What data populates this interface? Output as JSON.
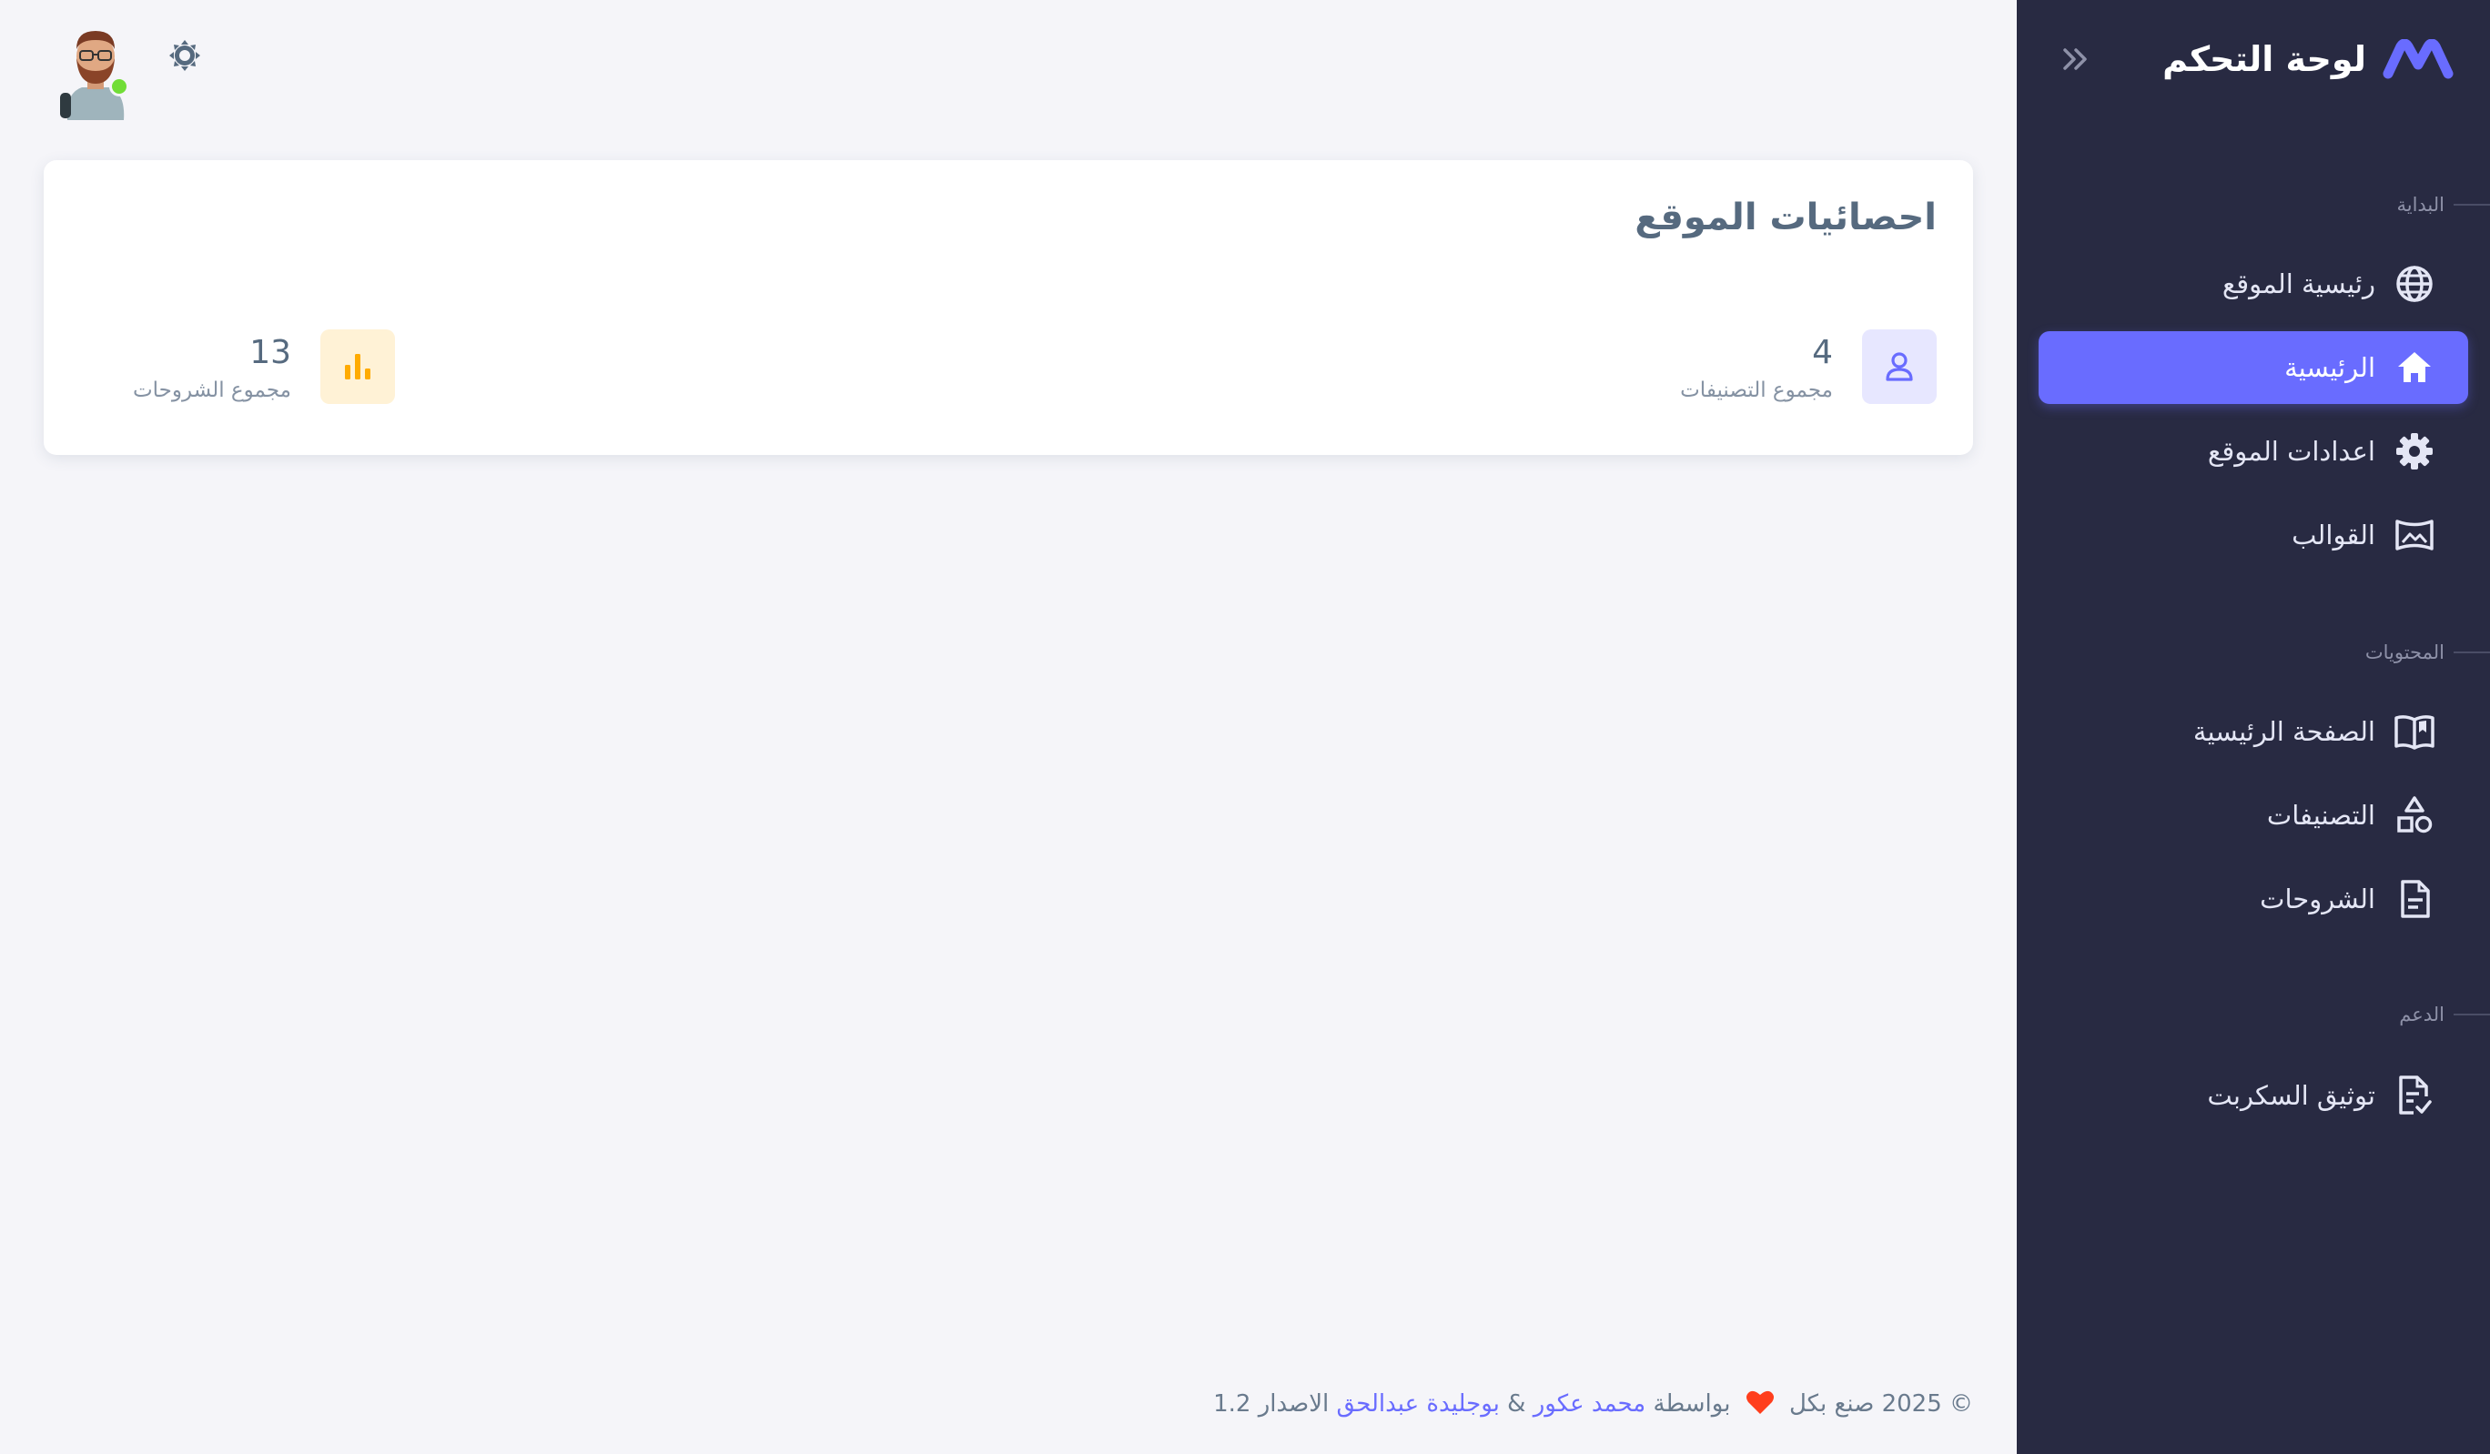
{
  "brand": {
    "title": "لوحة التحكم",
    "logo_icon": "m-logo-icon"
  },
  "sidebar": {
    "sections": [
      {
        "header": "البداية"
      },
      {
        "header": "المحتويات"
      },
      {
        "header": "الدعم"
      }
    ],
    "items": [
      {
        "label": "رئيسية الموقع",
        "icon": "globe-icon",
        "active": false
      },
      {
        "label": "الرئيسية",
        "icon": "home-icon",
        "active": true
      },
      {
        "label": "اعدادات الموقع",
        "icon": "gear-icon",
        "active": false
      },
      {
        "label": "القوالب",
        "icon": "image-frame-icon",
        "active": false
      },
      {
        "label": "الصفحة الرئيسية",
        "icon": "book-open-icon",
        "active": false
      },
      {
        "label": "التصنيفات",
        "icon": "shapes-icon",
        "active": false
      },
      {
        "label": "الشروحات",
        "icon": "document-icon",
        "active": false
      },
      {
        "label": "توثيق السكربت",
        "icon": "document-check-icon",
        "active": false
      }
    ]
  },
  "colors": {
    "sidebar_bg": "#282a42",
    "accent": "#696cff",
    "page_bg": "#f5f5f9",
    "warning": "#ffab00",
    "online": "#71dd37"
  },
  "card": {
    "title": "احصائيات الموقع",
    "stats": [
      {
        "value": "4",
        "label": "مجموع التصنيفات",
        "icon": "user-icon"
      },
      {
        "value": "13",
        "label": "مجموع الشروحات",
        "icon": "bar-chart-icon"
      }
    ]
  },
  "footer": {
    "prefix": "© 2025 صنع بكل",
    "by": "بواسطة",
    "author1": "محمد عكور",
    "amp": "&",
    "author2": "بوجليدة عبدالحق",
    "version": "الاصدار 1.2"
  }
}
